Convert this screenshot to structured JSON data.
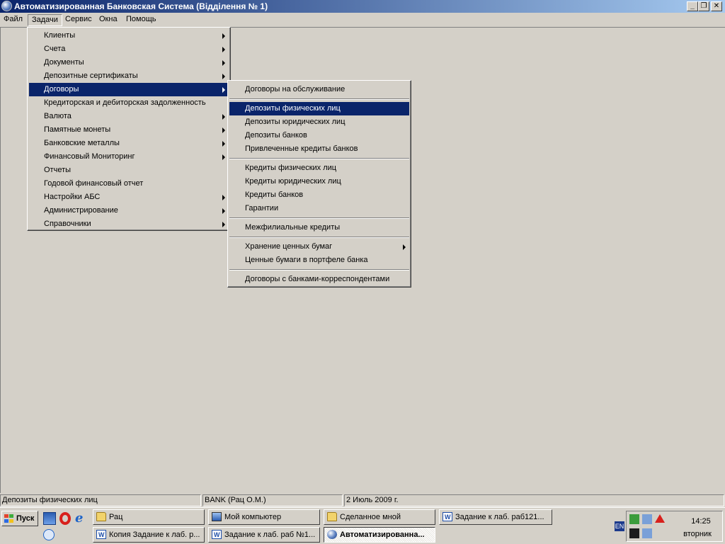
{
  "window": {
    "title": "Автоматизированная Банковская Система (Відділення № 1)",
    "buttons": {
      "minimize": "_",
      "restore": "❐",
      "close": "✕"
    }
  },
  "menubar": {
    "items": [
      "Файл",
      "Задачи",
      "Сервис",
      "Окна",
      "Помощь"
    ],
    "open_item": "Задачи"
  },
  "tasks_menu": {
    "items": [
      {
        "label": "Клиенты",
        "submenu": true
      },
      {
        "label": "Счета",
        "submenu": true
      },
      {
        "label": "Документы",
        "submenu": true
      },
      {
        "label": "Депозитные сертификаты",
        "submenu": true
      },
      {
        "label": "Договоры",
        "submenu": true,
        "highlighted": true
      },
      {
        "label": "Кредиторская и дебиторская задолженность",
        "submenu": false
      },
      {
        "label": "Валюта",
        "submenu": true
      },
      {
        "label": "Памятные монеты",
        "submenu": true
      },
      {
        "label": "Банковские металлы",
        "submenu": true
      },
      {
        "label": "Финансовый Мониторинг",
        "submenu": true
      },
      {
        "label": "Отчеты",
        "submenu": false
      },
      {
        "label": "Годовой финансовый отчет",
        "submenu": false
      },
      {
        "label": "Настройки АБС",
        "submenu": true
      },
      {
        "label": "Администрирование",
        "submenu": true
      },
      {
        "label": "Справочники",
        "submenu": true
      }
    ]
  },
  "contracts_submenu": {
    "items": [
      {
        "label": "Договоры на обслуживание"
      },
      {
        "label": "Депозиты физических лиц",
        "highlighted": true
      },
      {
        "label": "Депозиты юридических лиц"
      },
      {
        "label": "Депозиты банков"
      },
      {
        "label": "Привлеченные кредиты банков"
      },
      {
        "label": "Кредиты физических лиц"
      },
      {
        "label": "Кредиты юридических лиц"
      },
      {
        "label": "Кредиты банков"
      },
      {
        "label": "Гарантии"
      },
      {
        "label": "Межфилиальные кредиты"
      },
      {
        "label": "Хранение ценных бумаг",
        "submenu": true
      },
      {
        "label": "Ценные бумаги в портфеле банка"
      },
      {
        "label": "Договоры с банками-корреспондентами"
      }
    ]
  },
  "statusbar": {
    "hint": "Депозиты физических лиц",
    "user": "BANK (Рац О.М.)",
    "date": "2 Июль 2009 г."
  },
  "taskbar": {
    "start_label": "Пуск",
    "row1": [
      "Рац",
      "Мой компьютер",
      "Сделанное мной",
      "Задание к лаб. раб121..."
    ],
    "row2": [
      "Копия Задание к лаб. р...",
      "Задание к лаб. раб №1...",
      "Автоматизированна..."
    ],
    "language": "EN",
    "clock_time": "14:25",
    "clock_day": "вторник"
  },
  "colors": {
    "highlight": "#0a246a",
    "face": "#d4d0c8",
    "title_gradient_end": "#a6caf0"
  }
}
